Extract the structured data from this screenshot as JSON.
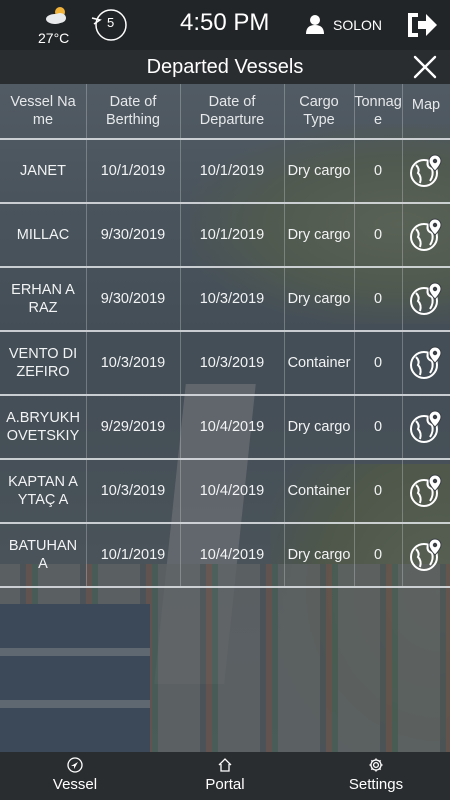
{
  "status_bar": {
    "temperature": "27°C",
    "wind_level": "5",
    "time": "4:50 PM",
    "username": "SOLON"
  },
  "header": {
    "title": "Departed Vessels"
  },
  "table": {
    "columns": [
      "Vessel Name",
      "Date of Berthing",
      "Date of Departure",
      "Cargo Type",
      "Tonnage",
      "Map"
    ],
    "rows": [
      {
        "vessel": "JANET",
        "berthing": "10/1/2019",
        "departure": "10/1/2019",
        "cargo": "Dry cargo",
        "tonnage": "0"
      },
      {
        "vessel": "MILLAC",
        "berthing": "9/30/2019",
        "departure": "10/1/2019",
        "cargo": "Dry cargo",
        "tonnage": "0"
      },
      {
        "vessel": "ERHAN ARAZ",
        "berthing": "9/30/2019",
        "departure": "10/3/2019",
        "cargo": "Dry cargo",
        "tonnage": "0"
      },
      {
        "vessel": "VENTO DI ZEFIRO",
        "berthing": "10/3/2019",
        "departure": "10/3/2019",
        "cargo": "Container",
        "tonnage": "0"
      },
      {
        "vessel": "A.BRYUKHOVETSKIY",
        "berthing": "9/29/2019",
        "departure": "10/4/2019",
        "cargo": "Dry cargo",
        "tonnage": "0"
      },
      {
        "vessel": "KAPTAN AYTAÇ A",
        "berthing": "10/3/2019",
        "departure": "10/4/2019",
        "cargo": "Container",
        "tonnage": "0"
      },
      {
        "vessel": "BATUHAN A",
        "berthing": "10/1/2019",
        "departure": "10/4/2019",
        "cargo": "Dry cargo",
        "tonnage": "0"
      }
    ]
  },
  "bottom_nav": {
    "vessel_label": "Vessel",
    "portal_label": "Portal",
    "settings_label": "Settings"
  },
  "icons": {
    "weather": "sun-cloud-icon",
    "wind": "wind-direction-icon",
    "user": "user-icon",
    "logout": "logout-icon",
    "close": "close-icon",
    "map": "globe-pin-icon",
    "vessel": "navigation-icon",
    "portal": "home-icon",
    "settings": "gear-icon"
  }
}
